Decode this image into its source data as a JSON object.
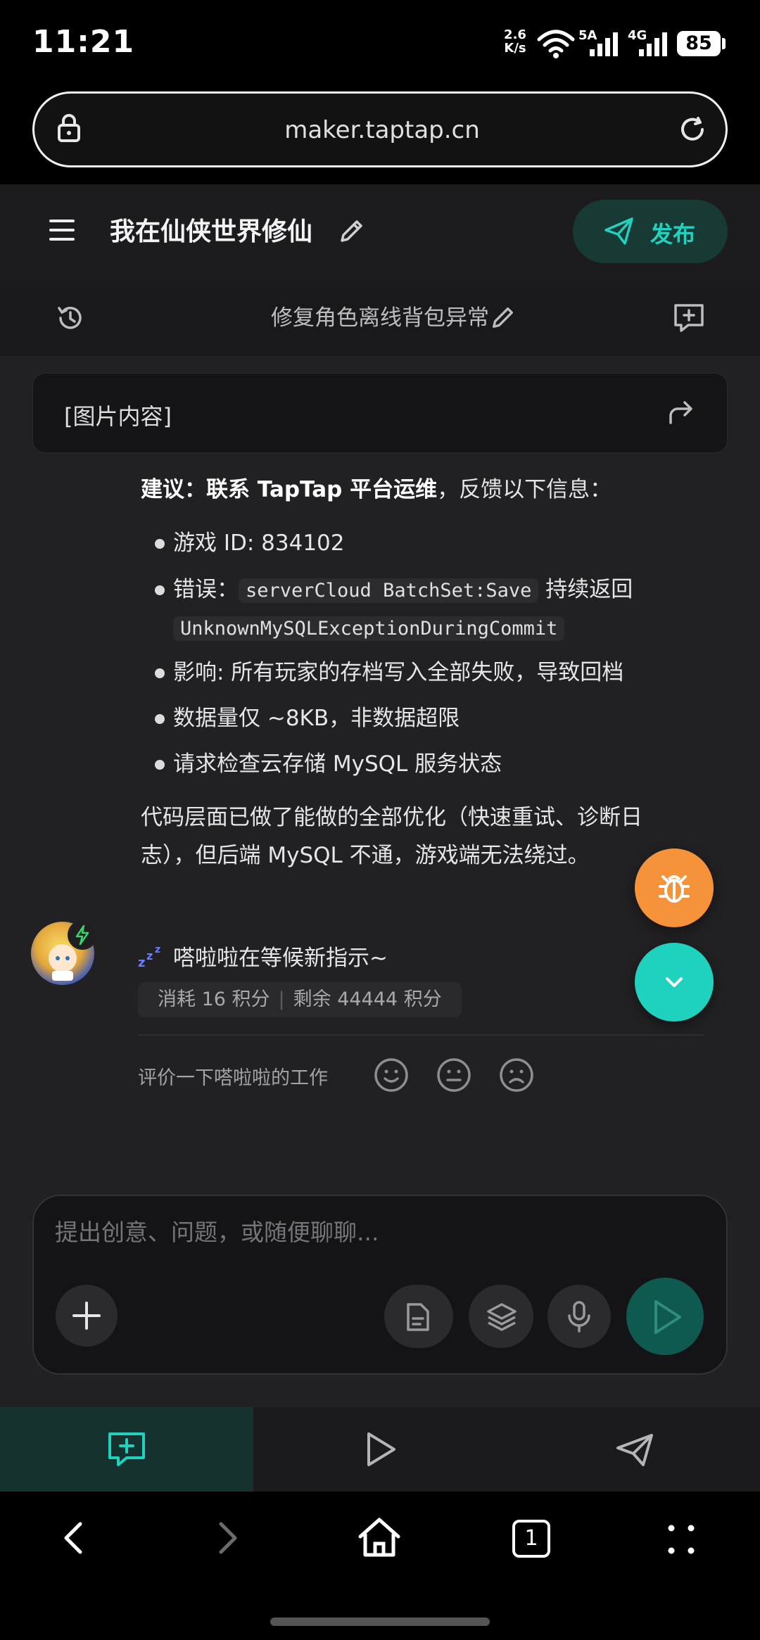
{
  "status_bar": {
    "time": "11:21",
    "net_speed_value": "2.6",
    "net_speed_unit": "K/s",
    "signal1_label": "5A",
    "signal2_label": "4G",
    "battery": "85"
  },
  "browser": {
    "url": "maker.taptap.cn"
  },
  "header": {
    "project_title": "我在仙侠世界修仙",
    "publish_label": "发布",
    "conversation_title": "修复角色离线背包异常"
  },
  "chat": {
    "image_card_label": "[图片内容]",
    "suggestion_bold": "建议：联系 TapTap 平台运维",
    "suggestion_rest": "，反馈以下信息：",
    "bullets": {
      "b1": "游戏 ID: 834102",
      "b2_prefix": "错误：",
      "b2_code1": "serverCloud BatchSet:Save",
      "b2_mid": " 持续返回",
      "b2_code2": "UnknownMySQLExceptionDuringCommit",
      "b3": "影响: 所有玩家的存档写入全部失败，导致回档",
      "b4": "数据量仅 ~8KB，非数据超限",
      "b5": "请求检查云存储 MySQL 服务状态"
    },
    "conclusion_line1": "代码层面已做了能做的全部优化（快速重试、诊断日",
    "conclusion_line2": "志），但后端 MySQL 不通，游戏端无法绕过。",
    "waiting_text": "嗒啦啦在等候新指示~",
    "usage_consumed": "消耗 16 积分",
    "usage_remaining": "剩余 44444 积分",
    "rate_prompt": "评价一下嗒啦啦的工作"
  },
  "composer": {
    "placeholder": "提出创意、问题，或随便聊聊..."
  },
  "colors": {
    "accent": "#1ed2bd",
    "bug_fab": "#f5923a",
    "background": "#212124"
  },
  "icons": [
    "lock-icon",
    "reload-icon",
    "menu-icon",
    "edit-icon",
    "send-icon",
    "history-icon",
    "new-chat-icon",
    "share-icon",
    "bug-icon",
    "chevron-down-icon",
    "sleep-icon",
    "smile-icon",
    "neutral-icon",
    "sad-icon",
    "plus-icon",
    "document-icon",
    "layers-icon",
    "mic-icon",
    "play-icon",
    "back-icon",
    "forward-icon",
    "home-icon",
    "apps-icon"
  ],
  "system_nav": {
    "tab_count": "1"
  }
}
